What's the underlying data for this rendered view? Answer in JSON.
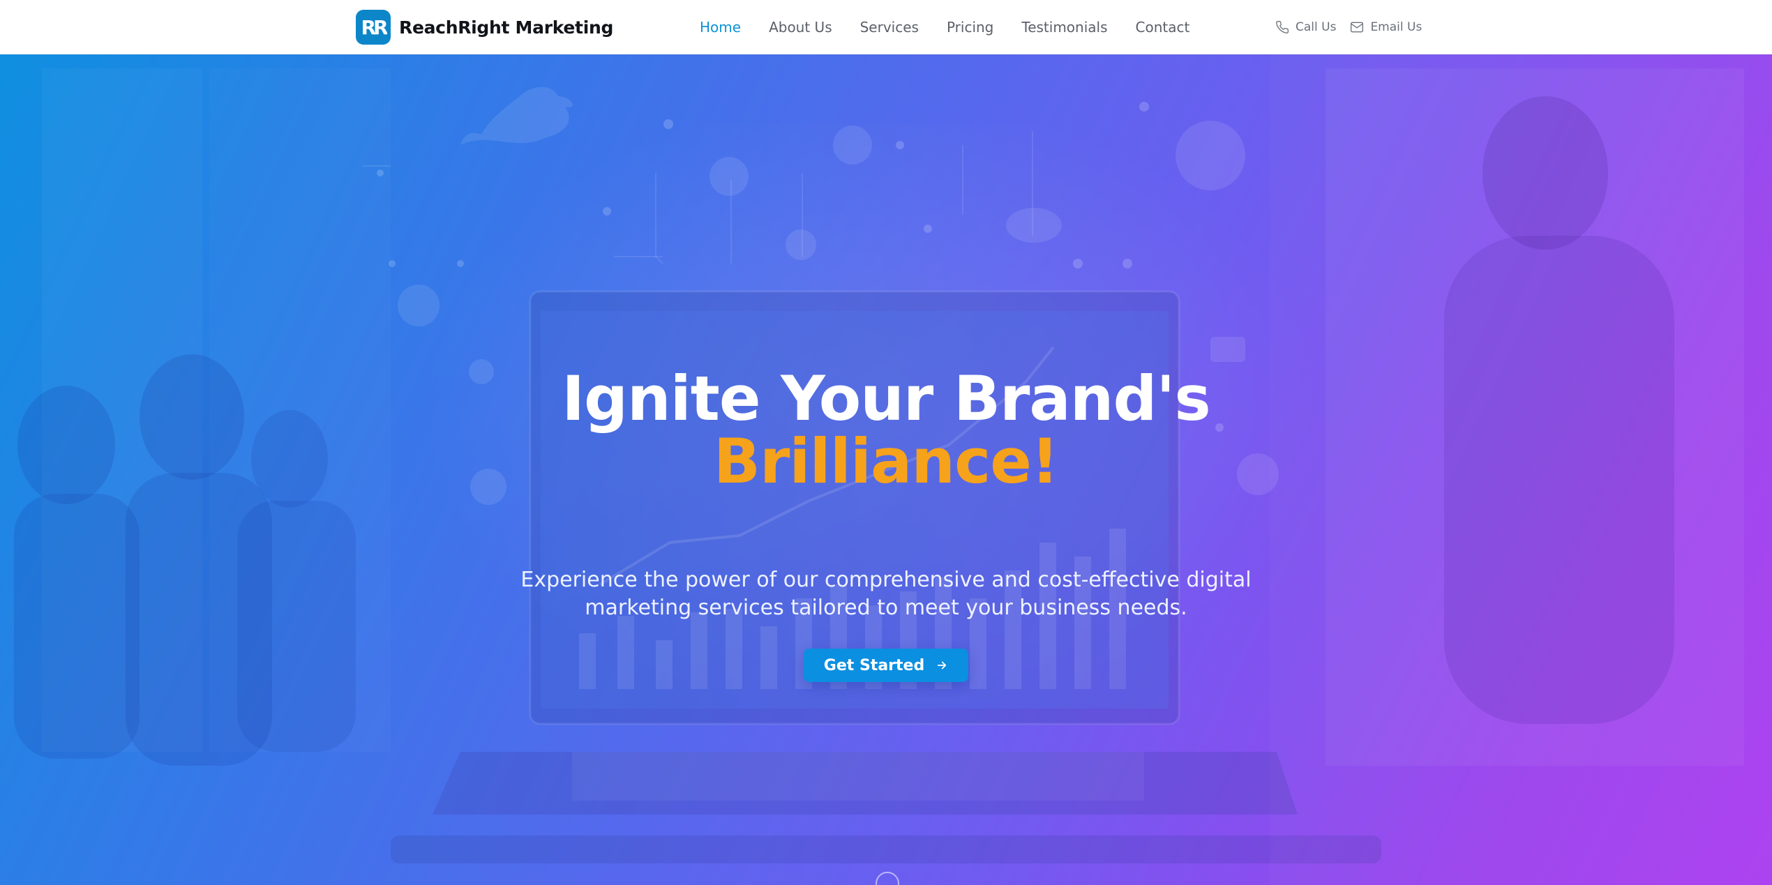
{
  "brand": {
    "logo_text": "RR",
    "name": "ReachRight Marketing",
    "logo_color": "#0c86c9"
  },
  "nav": {
    "items": [
      {
        "label": "Home",
        "active": true
      },
      {
        "label": "About Us",
        "active": false
      },
      {
        "label": "Services",
        "active": false
      },
      {
        "label": "Pricing",
        "active": false
      },
      {
        "label": "Testimonials",
        "active": false
      },
      {
        "label": "Contact",
        "active": false
      }
    ],
    "active_color": "#0d93d4"
  },
  "contact": {
    "call_label": "Call Us",
    "call_icon": "phone-icon",
    "email_label": "Email Us",
    "email_icon": "mail-icon"
  },
  "hero": {
    "headline": "Ignite Your Brand's",
    "headline_accent": "Brilliance!",
    "accent_color": "#f6a21b",
    "subheadline": "Experience the power of our comprehensive and cost-effective digital marketing services tailored to meet your business needs.",
    "cta_label": "Get Started",
    "cta_icon": "arrow-right-icon",
    "scroll_icon": "scroll-down-icon",
    "gradient_start": "#0f8fe0",
    "gradient_end": "#ab3ff0"
  }
}
